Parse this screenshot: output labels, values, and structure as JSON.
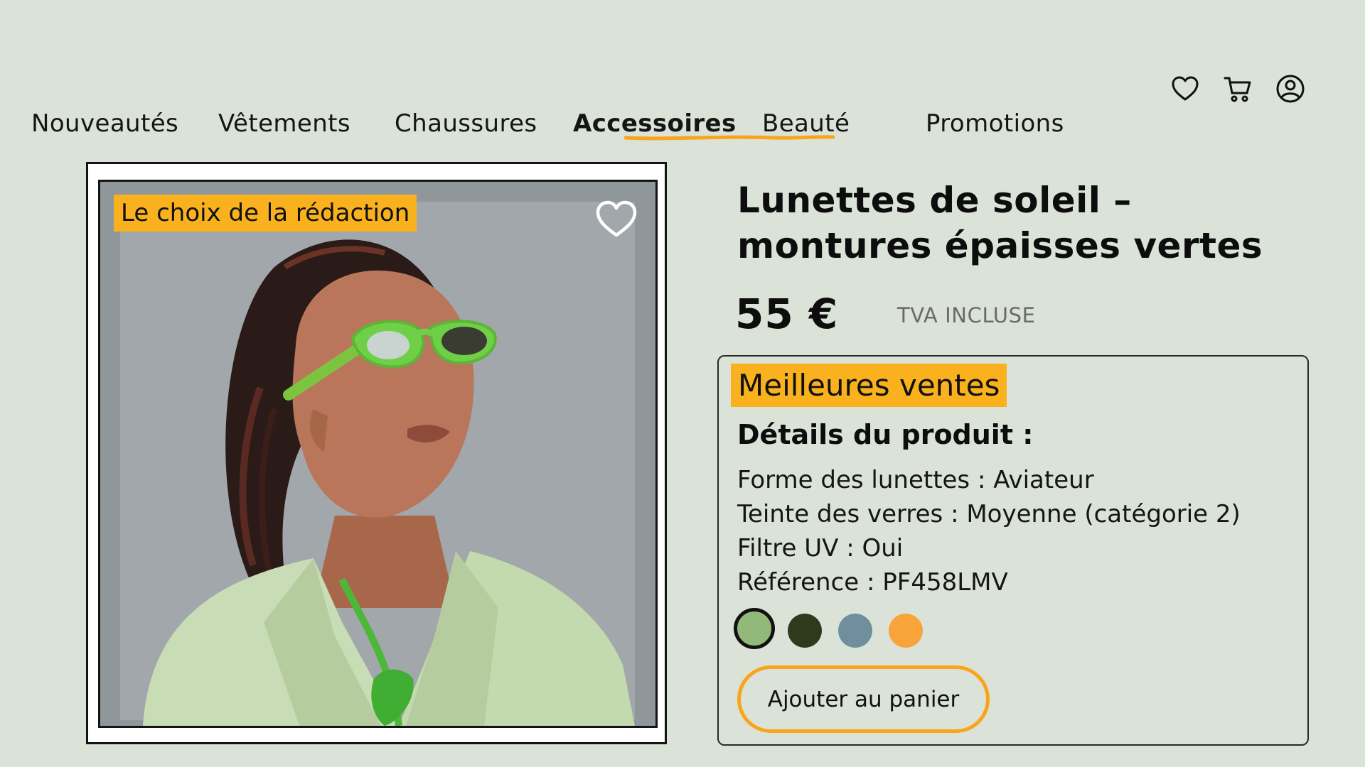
{
  "header": {
    "icons": [
      "heart-icon",
      "cart-icon",
      "user-icon"
    ]
  },
  "nav": {
    "items": [
      {
        "label": "Nouveautés"
      },
      {
        "label": "Vêtements"
      },
      {
        "label": "Chaussures"
      },
      {
        "label": "Accessoires",
        "active": true
      },
      {
        "label": "Beauté"
      },
      {
        "label": "Promotions"
      }
    ],
    "accent_color": "#f9a41a"
  },
  "product": {
    "image_badge": "Le choix de la rédaction",
    "title_line1": "Lunettes de soleil –",
    "title_line2": "montures épaisses vertes",
    "price": "55 €",
    "tax_note": "TVA INCLUSE",
    "bestseller_badge": "Meilleures ventes",
    "details_heading": "Détails du produit :",
    "details": [
      "Forme des lunettes : Aviateur",
      "Teinte des verres : Moyenne (catégorie 2)",
      "Filtre UV : Oui",
      "Référence :  PF458LMV"
    ],
    "colors": [
      {
        "hex": "#93b97a",
        "selected": true
      },
      {
        "hex": "#2f3a1c"
      },
      {
        "hex": "#6f8f9e"
      },
      {
        "hex": "#f9a43b"
      }
    ],
    "add_to_cart_label": "Ajouter au panier"
  },
  "theme": {
    "background": "#dbe2d7",
    "badge_color": "#f9b21d"
  }
}
